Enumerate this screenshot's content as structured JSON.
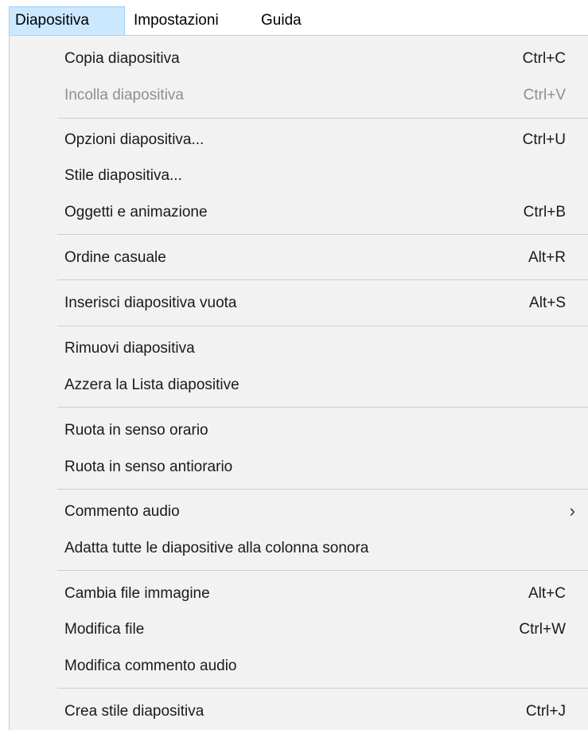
{
  "menubar": {
    "items": [
      {
        "label": "Diapositiva"
      },
      {
        "label": "Impostazioni"
      },
      {
        "label": "Guida"
      }
    ]
  },
  "dropdown": {
    "items": [
      {
        "label": "Copia diapositiva",
        "shortcut": "Ctrl+C",
        "enabled": true
      },
      {
        "label": "Incolla diapositiva",
        "shortcut": "Ctrl+V",
        "enabled": false
      },
      {
        "label": "Opzioni diapositiva...",
        "shortcut": "Ctrl+U",
        "enabled": true
      },
      {
        "label": "Stile diapositiva...",
        "shortcut": "",
        "enabled": true
      },
      {
        "label": "Oggetti e animazione",
        "shortcut": "Ctrl+B",
        "enabled": true
      },
      {
        "label": "Ordine casuale",
        "shortcut": "Alt+R",
        "enabled": true
      },
      {
        "label": "Inserisci diapositiva vuota",
        "shortcut": "Alt+S",
        "enabled": true
      },
      {
        "label": "Rimuovi diapositiva",
        "shortcut": "",
        "enabled": true
      },
      {
        "label": "Azzera la Lista diapositive",
        "shortcut": "",
        "enabled": true
      },
      {
        "label": "Ruota in senso orario",
        "shortcut": "",
        "enabled": true
      },
      {
        "label": "Ruota in senso antiorario",
        "shortcut": "",
        "enabled": true
      },
      {
        "label": "Commento audio",
        "shortcut": "",
        "enabled": true,
        "submenu_icon": "chevron-right-icon"
      },
      {
        "label": "Adatta tutte le diapositive alla colonna sonora",
        "shortcut": "",
        "enabled": true
      },
      {
        "label": "Cambia file immagine",
        "shortcut": "Alt+C",
        "enabled": true
      },
      {
        "label": "Modifica file",
        "shortcut": "Ctrl+W",
        "enabled": true
      },
      {
        "label": "Modifica commento audio",
        "shortcut": "",
        "enabled": true
      },
      {
        "label": "Crea stile diapositiva",
        "shortcut": "Ctrl+J",
        "enabled": true
      }
    ],
    "submenu_arrow": "›"
  },
  "colors": {
    "menu_background": "#f2f2f2",
    "active_menubar_item": "#cce8ff",
    "disabled_text": "#8f8f8f"
  }
}
